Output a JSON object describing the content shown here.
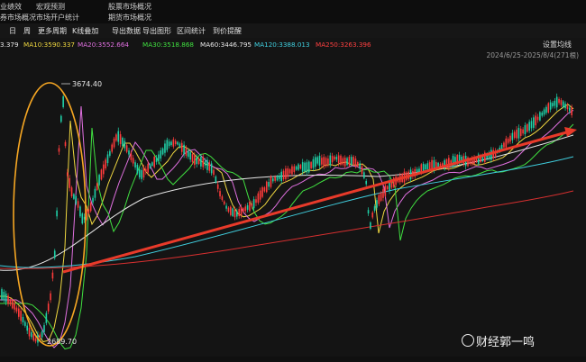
{
  "top_menu": {
    "row1": [
      "业绩效",
      "宏观预测",
      "股票市场概况"
    ],
    "row2": [
      "券市场概况",
      "市场开户统计",
      "期货市场概况"
    ]
  },
  "toolbar": {
    "items": [
      "日",
      "周",
      "更多周期",
      "K线叠加",
      "导出数据",
      "导出图形",
      "区间统计",
      "到价提醒"
    ],
    "setting": "设置均线"
  },
  "ma_bar": [
    {
      "label": "3.379",
      "color": "#e8e8e8"
    },
    {
      "label": "MA10:3590.337",
      "color": "#f0d840"
    },
    {
      "label": "MA20:3552.664",
      "color": "#e070e0"
    },
    {
      "label": "MA30:3518.868",
      "color": "#40e040"
    },
    {
      "label": "MA60:3446.795",
      "color": "#e8e8e8"
    },
    {
      "label": "MA120:3388.013",
      "color": "#40d0e0"
    },
    {
      "label": "MA250:3263.396",
      "color": "#ff4040"
    }
  ],
  "range_label": "2024/6/25-2025/8/4(271根)",
  "price_labels": {
    "high": "3674.40",
    "low": "2689.70"
  },
  "watermark": "财经郭一鸣",
  "colors": {
    "up": "#ff3b3b",
    "down": "#1fd1a8",
    "circle": "#f5a623",
    "trend": "#e83a2a"
  }
}
